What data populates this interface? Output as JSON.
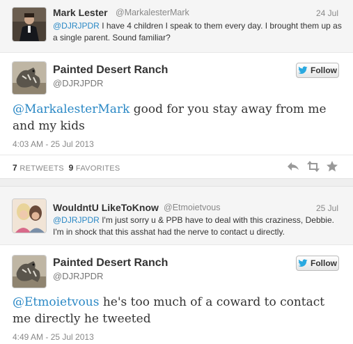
{
  "reply1": {
    "name": "Mark Lester",
    "handle": "@MarkalesterMark",
    "date": "24 Jul",
    "mention": "@DJRJPDR",
    "text": " I have 4 children I speak to them every day. I brought them up as a single parent. Sound familiar?"
  },
  "tweet1": {
    "name": "Painted Desert Ranch",
    "handle": "@DJRJPDR",
    "follow_label": "Follow",
    "mention": "@MarkalesterMark",
    "text": " good for you stay away from me and my kids",
    "timestamp": "4:03 AM - 25 Jul 2013",
    "retweets_count": "7",
    "retweets_label": "RETWEETS",
    "favorites_count": "9",
    "favorites_label": "FAVORITES"
  },
  "reply2": {
    "name": "WouldntU LikeToKnow",
    "handle": "@Etmoietvous",
    "date": "25 Jul",
    "mention": "@DJRJPDR",
    "text": " I'm just sorry u & PPB have to deal with this craziness, Debbie. I'm in shock that this asshat had the nerve to contact u directly."
  },
  "tweet2": {
    "name": "Painted Desert Ranch",
    "handle": "@DJRJPDR",
    "follow_label": "Follow",
    "mention": "@Etmoietvous",
    "text": " he's too much of a coward to contact me directly he tweeted",
    "timestamp": "4:49 AM - 25 Jul 2013"
  },
  "colors": {
    "mention": "#2a88c5",
    "twitter_bird": "#2aa9e0"
  },
  "icons": [
    "reply-icon",
    "retweet-icon",
    "favorite-icon",
    "twitter-bird-icon"
  ]
}
